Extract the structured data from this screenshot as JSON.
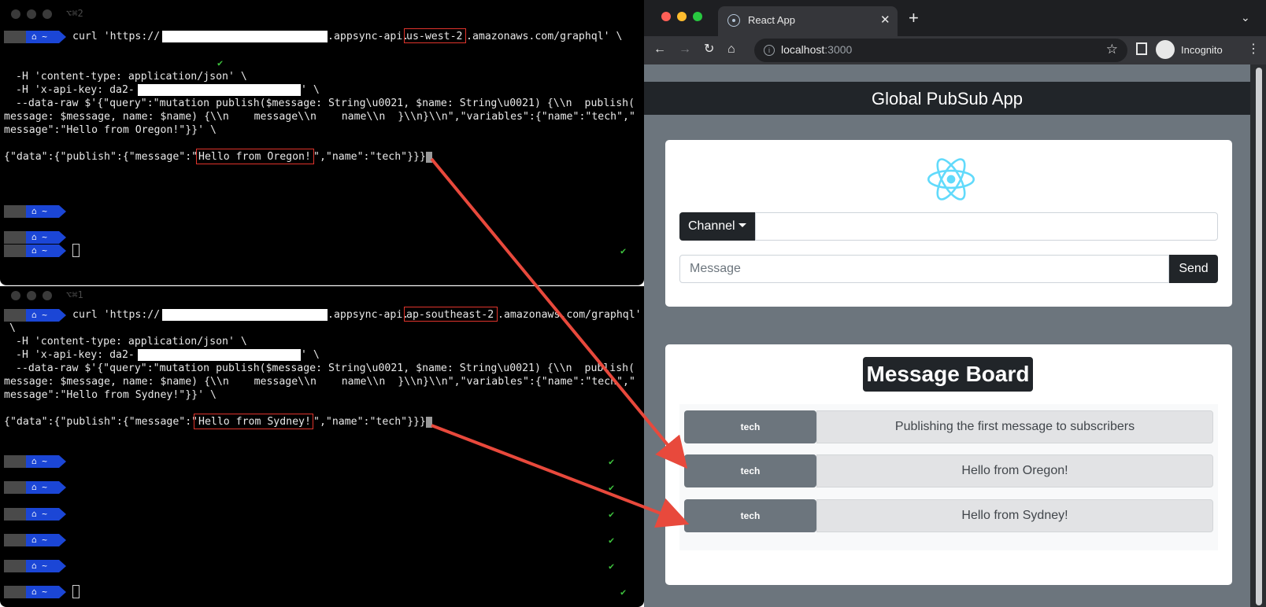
{
  "terminal_top": {
    "tab_title": "⌥⌘2",
    "curl_prefix": "curl 'https://",
    "curl_host_mid": ".appsync-api.",
    "region": "us-west-2",
    "curl_host_end": ".amazonaws.com/graphql' \\",
    "header_content_type": "-H 'content-type: application/json' \\",
    "header_api_key_prefix": "-H 'x-api-key: da2-",
    "header_api_key_suffix": "' \\",
    "data_line_1": "--data-raw $'{\"query\":\"mutation publish($message: String\\u0021, $name: String\\u0021) {\\\\n  publish(",
    "data_line_2": "message: $message, name: $name) {\\\\n    message\\\\n    name\\\\n  }\\\\n}\\\\n\",\"variables\":{\"name\":\"tech\",\"",
    "data_line_3": "message\":\"Hello from Oregon!\"}}' \\",
    "response_prefix": "{\"data\":{\"publish\":{\"message\":\"",
    "response_message": "Hello from Oregon!",
    "response_suffix": "\",\"name\":\"tech\"}}}"
  },
  "terminal_bottom": {
    "tab_title": "⌥⌘1",
    "curl_prefix": "curl 'https://",
    "curl_host_mid": ".appsync-api.",
    "region": "ap-southeast-2",
    "curl_host_end": ".amazonaws.com/graphql'",
    "continuation": "\\",
    "header_content_type": "-H 'content-type: application/json' \\",
    "header_api_key_prefix": "-H 'x-api-key: da2-",
    "header_api_key_suffix": "' \\",
    "data_line_1": "--data-raw $'{\"query\":\"mutation publish($message: String\\u0021, $name: String\\u0021) {\\\\n  publish(",
    "data_line_2": "message: $message, name: $name) {\\\\n    message\\\\n    name\\\\n  }\\\\n}\\\\n\",\"variables\":{\"name\":\"tech\",\"",
    "data_line_3": "message\":\"Hello from Sydney!\"}}' \\",
    "response_prefix": "{\"data\":{\"publish\":{\"message\":\"",
    "response_message": "Hello from Sydney!",
    "response_suffix": "\",\"name\":\"tech\"}}}"
  },
  "prompt": {
    "apple_icon": "apple-icon",
    "home_icon": "home-icon",
    "home_glyph": "⌂",
    "tilde": "~",
    "check_glyph": "✔",
    "check_color": "#3ec43e"
  },
  "browser": {
    "tab_label": "React App",
    "tab_close": "✕",
    "new_tab": "+",
    "tab_list": "⌄",
    "url_host": "localhost",
    "url_port": ":3000",
    "incognito_label": "Incognito",
    "back_glyph": "←",
    "forward_glyph": "→",
    "reload_glyph": "↻",
    "home_glyph": "⌂",
    "star_glyph": "☆",
    "menu_glyph": "⋮",
    "info_glyph": "i"
  },
  "app": {
    "brand": "Global PubSub App",
    "channel_button": "Channel",
    "channel_value": "",
    "message_placeholder": "Message",
    "send_button": "Send",
    "board_title": "Message Board",
    "messages": [
      {
        "channel": "tech",
        "text": "Publishing the first message to subscribers"
      },
      {
        "channel": "tech",
        "text": "Hello from Oregon!"
      },
      {
        "channel": "tech",
        "text": "Hello from Sydney!"
      }
    ],
    "react_logo_color": "#61dafb",
    "dark_color": "#212529",
    "secondary_color": "#6c757d"
  },
  "annotation_color": "#e8493c"
}
